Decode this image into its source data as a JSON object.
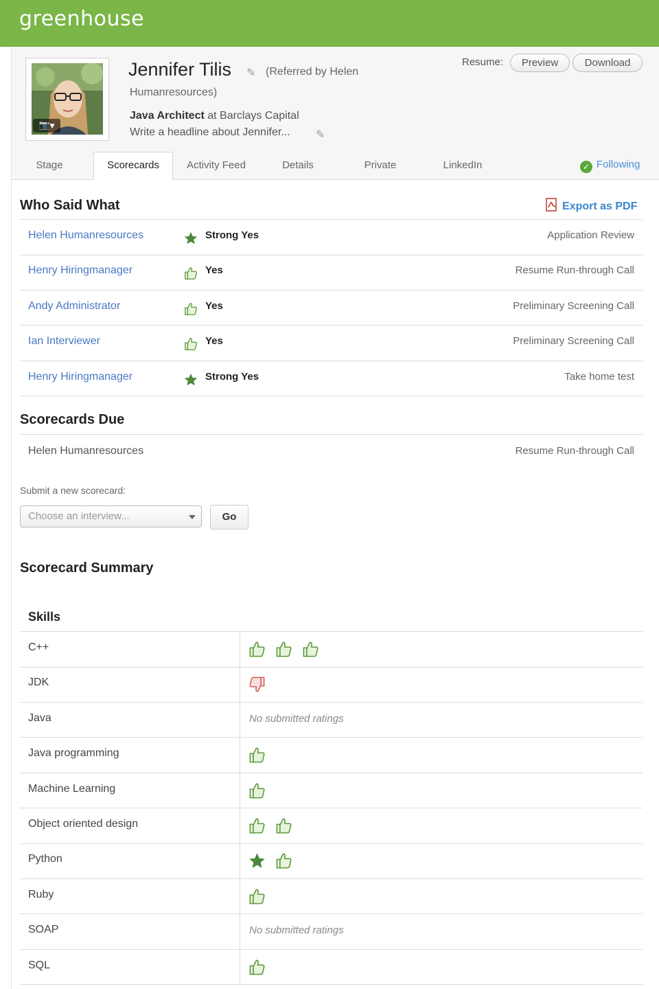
{
  "app": {
    "logo": "greenhouse"
  },
  "candidate": {
    "name": "Jennifer Tilis",
    "referred_line1": "(Referred by Helen",
    "referred_line2": "Humanresources)",
    "job_title": "Java Architect",
    "job_at": " at Barclays Capital",
    "headline_placeholder": "Write a headline about Jennifer..."
  },
  "resume": {
    "label": "Resume:",
    "preview": "Preview",
    "download": "Download"
  },
  "tabs": [
    {
      "label": "Stage",
      "active": false
    },
    {
      "label": "Scorecards",
      "active": true
    },
    {
      "label": "Activity Feed",
      "active": false
    },
    {
      "label": "Details",
      "active": false
    },
    {
      "label": "Private",
      "active": false
    },
    {
      "label": "LinkedIn",
      "active": false
    }
  ],
  "following": "Following",
  "who_said_what": {
    "title": "Who Said What",
    "export": "Export as PDF",
    "rows": [
      {
        "name": "Helen Humanresources",
        "rating": "Strong Yes",
        "icon": "star-icon",
        "stage": "Application Review"
      },
      {
        "name": "Henry Hiringmanager",
        "rating": "Yes",
        "icon": "thumbs-up-icon",
        "stage": "Resume Run-through Call"
      },
      {
        "name": "Andy Administrator",
        "rating": "Yes",
        "icon": "thumbs-up-icon",
        "stage": "Preliminary Screening Call"
      },
      {
        "name": "Ian Interviewer",
        "rating": "Yes",
        "icon": "thumbs-up-icon",
        "stage": "Preliminary Screening Call"
      },
      {
        "name": "Henry Hiringmanager",
        "rating": "Strong Yes",
        "icon": "star-icon",
        "stage": "Take home test"
      }
    ]
  },
  "scorecards_due": {
    "title": "Scorecards Due",
    "name": "Helen Humanresources",
    "stage": "Resume Run-through Call",
    "submit_label": "Submit a new scorecard:",
    "select_placeholder": "Choose an interview...",
    "go": "Go"
  },
  "summary": {
    "title": "Scorecard Summary",
    "skills_header": "Skills",
    "no_ratings": "No submitted ratings",
    "skills": [
      {
        "name": "C++",
        "ratings": [
          "yes",
          "yes",
          "yes"
        ]
      },
      {
        "name": "JDK",
        "ratings": [
          "no"
        ]
      },
      {
        "name": "Java",
        "ratings": []
      },
      {
        "name": "Java programming",
        "ratings": [
          "yes"
        ]
      },
      {
        "name": "Machine Learning",
        "ratings": [
          "yes"
        ]
      },
      {
        "name": "Object oriented design",
        "ratings": [
          "yes",
          "yes"
        ]
      },
      {
        "name": "Python",
        "ratings": [
          "strong_yes",
          "yes"
        ]
      },
      {
        "name": "Ruby",
        "ratings": [
          "yes"
        ]
      },
      {
        "name": "SOAP",
        "ratings": []
      },
      {
        "name": "SQL",
        "ratings": [
          "yes"
        ]
      }
    ]
  },
  "colors": {
    "brand": "#7ab648",
    "link": "#4a78c4",
    "rating_green": "#5a8a3c",
    "rating_red": "#d9534f"
  }
}
